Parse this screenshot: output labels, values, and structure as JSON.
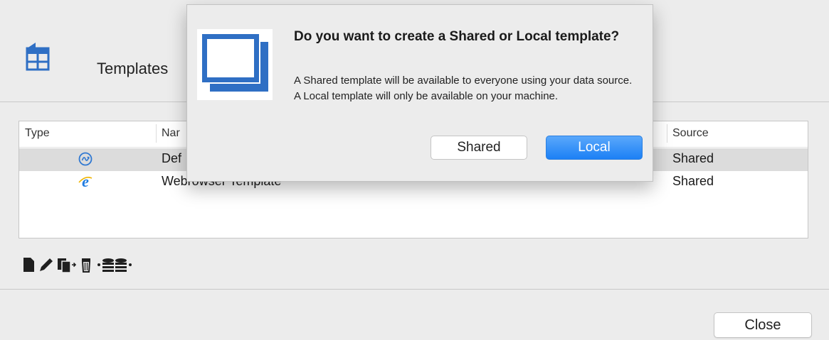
{
  "header": {
    "title": "Templates",
    "icon": "template-icon"
  },
  "table": {
    "columns": [
      "Type",
      "Nar",
      "Source"
    ],
    "rows": [
      {
        "type_icon": "template-type-icon",
        "name": "Def",
        "source": "Shared",
        "selected": true
      },
      {
        "type_icon": "internet-explorer-icon",
        "name": "Webrowser Template",
        "source": "Shared",
        "selected": false
      }
    ]
  },
  "toolbar": {
    "buttons": [
      "new-template-icon",
      "edit-icon",
      "copy-icon",
      "delete-icon",
      "database-icon"
    ]
  },
  "footer": {
    "close_label": "Close"
  },
  "dialog": {
    "title": "Do you want to create a Shared or Local template?",
    "message": "A Shared template will be available to everyone using your data source. A Local template will only be available on your machine.",
    "shared_label": "Shared",
    "local_label": "Local",
    "icon": "window-icon"
  },
  "colors": {
    "accent": "#1c80f5",
    "icon_blue": "#2f6fc4"
  }
}
